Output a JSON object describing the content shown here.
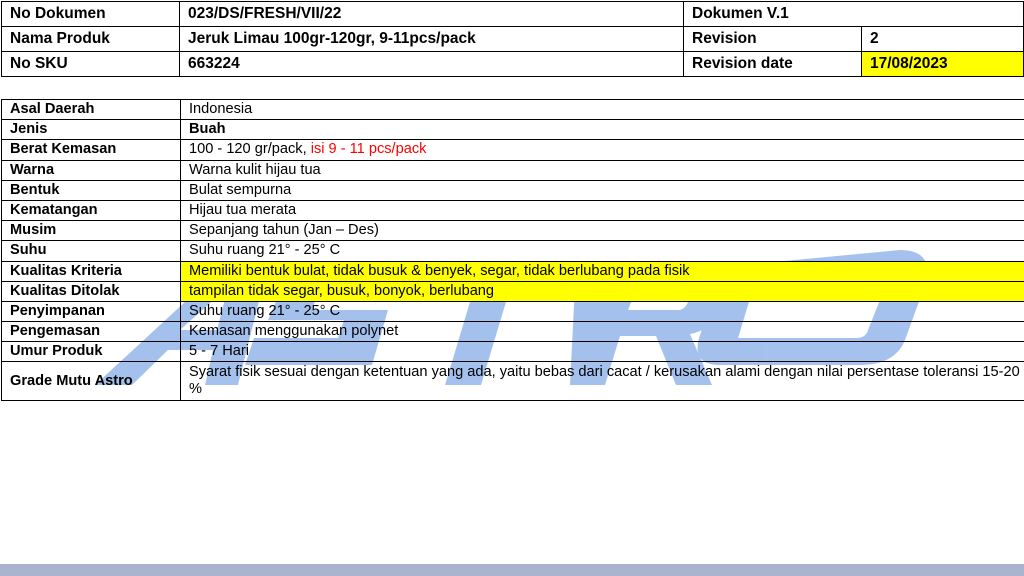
{
  "header": {
    "doc_no_label": "No Dokumen",
    "doc_no_value": "023/DS/FRESH/VII/22",
    "doc_version": "Dokumen V.1",
    "product_label": "Nama Produk",
    "product_value": "Jeruk Limau 100gr-120gr, 9-11pcs/pack",
    "revision_label": "Revision",
    "revision_value": "2",
    "sku_label": "No SKU",
    "sku_value": "663224",
    "revision_date_label": "Revision date",
    "revision_date_value": "17/08/2023"
  },
  "spec": {
    "asal_label": "Asal Daerah",
    "asal_value": "Indonesia",
    "jenis_label": "Jenis",
    "jenis_value": "Buah",
    "berat_label": "Berat Kemasan",
    "berat_value": "100 - 120 gr/pack, ",
    "berat_note": "isi 9 - 11 pcs/pack",
    "warna_label": "Warna",
    "warna_value": "Warna kulit hijau tua",
    "bentuk_label": "Bentuk",
    "bentuk_value": "Bulat sempurna",
    "kematangan_label": "Kematangan",
    "kematangan_value": "Hijau tua merata",
    "musim_label": "Musim",
    "musim_value": "Sepanjang tahun (Jan – Des)",
    "suhu_label": "Suhu",
    "suhu_value": "Suhu ruang  21° - 25° C",
    "kriteria_label": "Kualitas Kriteria",
    "kriteria_value": "Memiliki bentuk bulat, tidak busuk & benyek, segar, tidak berlubang pada fisik",
    "ditolak_label": "Kualitas Ditolak",
    "ditolak_value": "tampilan tidak segar, busuk, bonyok, berlubang",
    "penyimpanan_label": "Penyimpanan",
    "penyimpanan_value": "Suhu ruang  21° - 25° C",
    "pengemasan_label": "Pengemasan",
    "pengemasan_value": "Kemasan menggunakan polynet",
    "umur_label": "Umur Produk",
    "umur_value": "5 - 7 Hari",
    "grade_label": "Grade Mutu Astro",
    "grade_value": "Syarat fisik sesuai dengan ketentuan yang ada, yaitu bebas dari cacat / kerusakan alami dengan  nilai persentase toleransi 15-20 %"
  },
  "colors": {
    "highlight": "#ffff00",
    "note_red": "#ff0000",
    "watermark_blue": "#5b8fe0",
    "footer_band": "#aab4cf"
  }
}
